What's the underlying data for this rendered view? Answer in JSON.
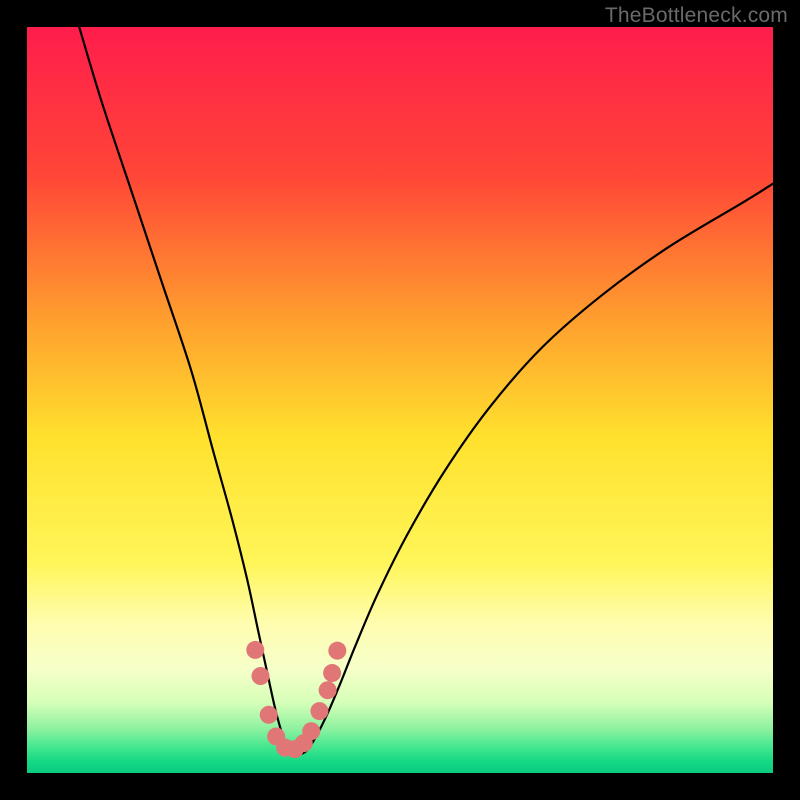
{
  "watermark": "TheBottleneck.com",
  "chart_data": {
    "type": "line",
    "title": "",
    "xlabel": "",
    "ylabel": "",
    "xlim": [
      0,
      100
    ],
    "ylim": [
      0,
      100
    ],
    "background_gradient_stops": [
      {
        "offset": 0.0,
        "color": "#ff1d4c"
      },
      {
        "offset": 0.2,
        "color": "#ff4637"
      },
      {
        "offset": 0.4,
        "color": "#ffa22e"
      },
      {
        "offset": 0.55,
        "color": "#ffe12d"
      },
      {
        "offset": 0.72,
        "color": "#fff65a"
      },
      {
        "offset": 0.8,
        "color": "#fffdb0"
      },
      {
        "offset": 0.86,
        "color": "#f6ffc9"
      },
      {
        "offset": 0.905,
        "color": "#d7ffb9"
      },
      {
        "offset": 0.94,
        "color": "#8ff2a0"
      },
      {
        "offset": 0.965,
        "color": "#45e78f"
      },
      {
        "offset": 0.985,
        "color": "#14d885"
      },
      {
        "offset": 1.0,
        "color": "#0bca7f"
      }
    ],
    "series": [
      {
        "name": "bottleneck-curve",
        "x": [
          7.0,
          10,
          14,
          18,
          22,
          25,
          27.5,
          29.5,
          31,
          32.3,
          33.3,
          34.3,
          35.3,
          36.3,
          37.5,
          38.8,
          40.3,
          42,
          44,
          47,
          51,
          56,
          62,
          69,
          77,
          86,
          96,
          100
        ],
        "y": [
          100,
          90,
          78,
          66,
          54,
          43,
          34,
          26,
          19,
          13,
          8.5,
          5,
          3,
          2.5,
          3,
          5,
          8,
          12,
          17,
          24,
          32,
          40.5,
          49,
          57,
          64,
          70.5,
          76.5,
          79
        ]
      }
    ],
    "markers": {
      "name": "highlight-dots",
      "color": "#e07676",
      "radius_px": 9,
      "points": [
        {
          "x": 30.6,
          "y": 16.5
        },
        {
          "x": 31.3,
          "y": 13.0
        },
        {
          "x": 32.4,
          "y": 7.8
        },
        {
          "x": 33.4,
          "y": 4.9
        },
        {
          "x": 34.6,
          "y": 3.4
        },
        {
          "x": 35.9,
          "y": 3.2
        },
        {
          "x": 37.1,
          "y": 4.0
        },
        {
          "x": 38.1,
          "y": 5.6
        },
        {
          "x": 39.2,
          "y": 8.3
        },
        {
          "x": 40.3,
          "y": 11.1
        },
        {
          "x": 40.9,
          "y": 13.4
        },
        {
          "x": 41.6,
          "y": 16.4
        }
      ]
    }
  }
}
